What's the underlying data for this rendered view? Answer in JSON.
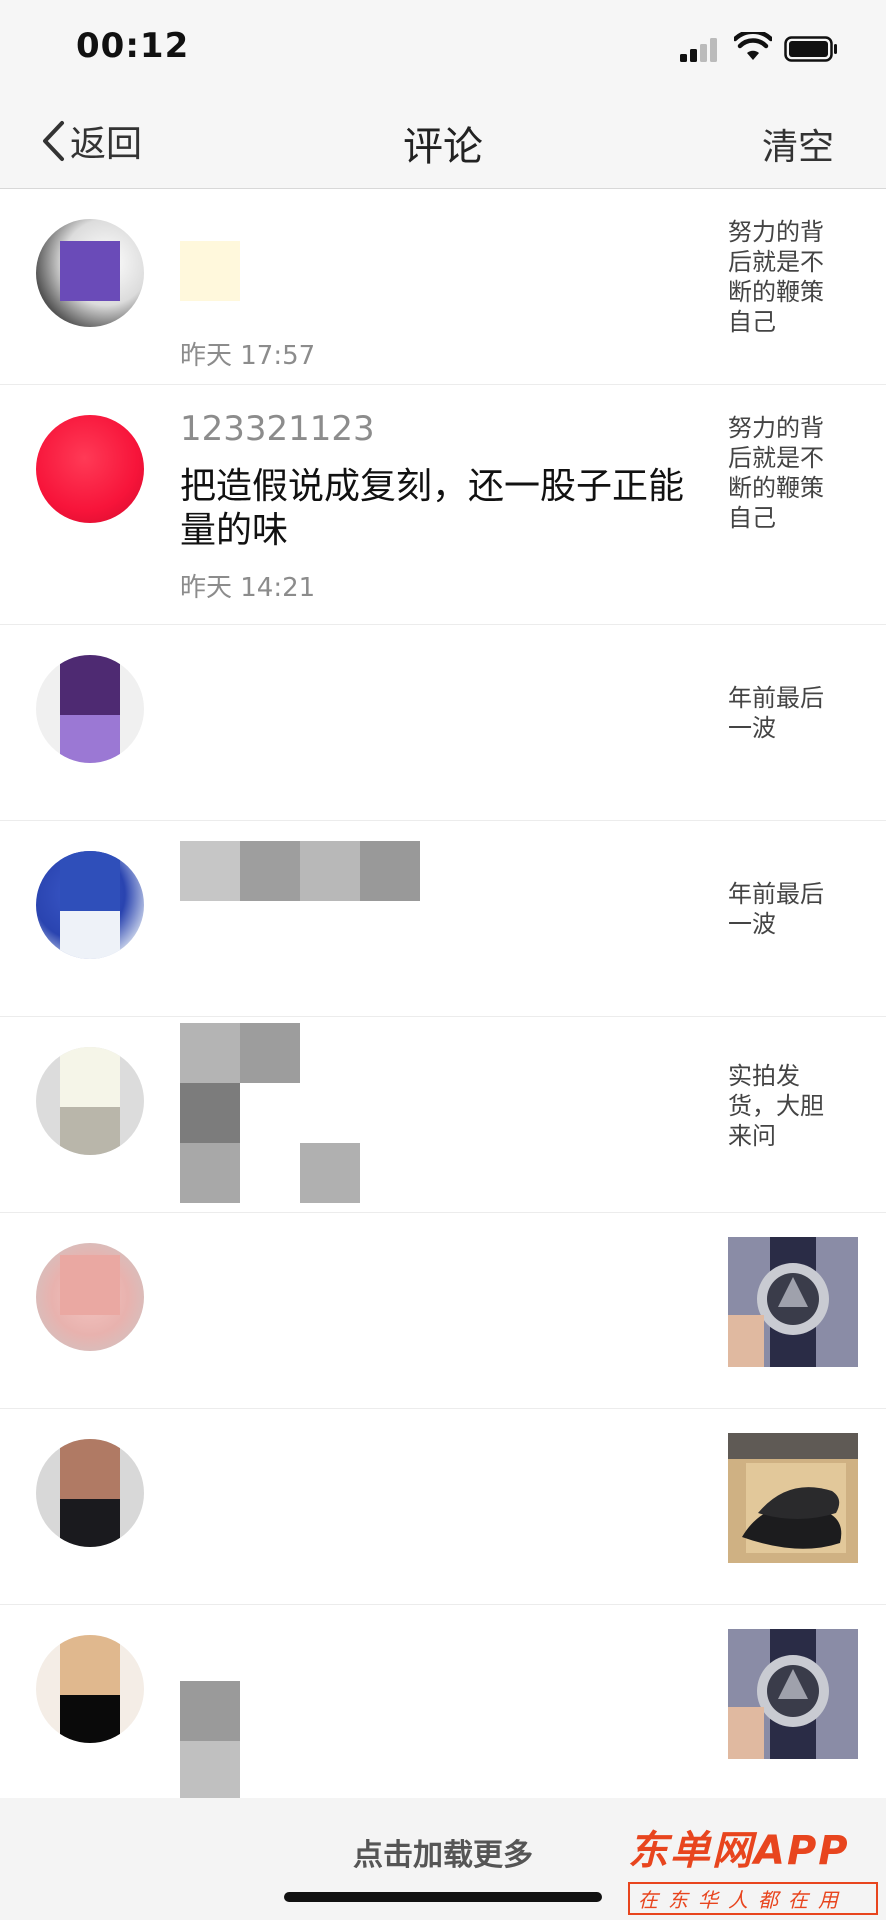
{
  "status": {
    "time": "00:12"
  },
  "nav": {
    "back_label": "返回",
    "title": "评论",
    "clear_label": "清空"
  },
  "comments": [
    {
      "time": "昨天 17:57",
      "ref": "努力的背后就是不断的鞭策自己"
    },
    {
      "name": "123321123",
      "content": "把造假说成复刻，还一股子正能量的味",
      "time": "昨天 14:21",
      "ref": "努力的背后就是不断的鞭策自己"
    },
    {
      "ref": "年前最后一波"
    },
    {
      "ref": "年前最后一波"
    },
    {
      "ref": "实拍发货，大胆来问"
    },
    {
      "thumb": "watch-photo"
    },
    {
      "thumb": "sneakers-photo"
    },
    {
      "thumb": "watch-photo"
    }
  ],
  "footer": {
    "load_more": "点击加载更多"
  },
  "watermark": {
    "brand": "东单网APP",
    "slogan": "在东华人都在用"
  }
}
